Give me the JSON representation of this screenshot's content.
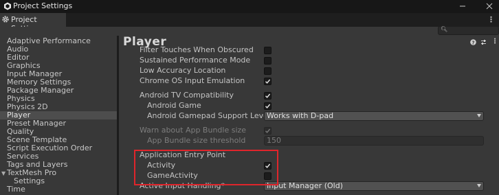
{
  "window": {
    "title": "Project Settings",
    "tab_label": "Project Settings"
  },
  "sidebar": {
    "items": [
      {
        "label": "Adaptive Performance"
      },
      {
        "label": "Audio"
      },
      {
        "label": "Editor"
      },
      {
        "label": "Graphics"
      },
      {
        "label": "Input Manager"
      },
      {
        "label": "Memory Settings"
      },
      {
        "label": "Package Manager"
      },
      {
        "label": "Physics"
      },
      {
        "label": "Physics 2D"
      },
      {
        "label": "Player",
        "selected": true
      },
      {
        "label": "Preset Manager"
      },
      {
        "label": "Quality"
      },
      {
        "label": "Scene Template"
      },
      {
        "label": "Script Execution Order"
      },
      {
        "label": "Services"
      },
      {
        "label": "Tags and Layers"
      },
      {
        "label": "TextMesh Pro",
        "foldout": "expanded"
      },
      {
        "label": "Settings",
        "indent": 1
      },
      {
        "label": "Time"
      }
    ]
  },
  "main": {
    "title": "Player",
    "rows": [
      {
        "label": "Filter Touches When Obscured",
        "checked": false
      },
      {
        "label": "Sustained Performance Mode",
        "checked": false
      },
      {
        "label": "Low Accuracy Location",
        "checked": false
      },
      {
        "label": "Chrome OS Input Emulation",
        "checked": true
      },
      {
        "label": "Android TV Compatibility",
        "checked": true
      },
      {
        "label": "Android Game",
        "checked": true
      },
      {
        "label": "Android Gamepad Support Level",
        "value": "Works with D-pad"
      },
      {
        "label": "Warn about App Bundle size",
        "checked": true,
        "disabled": true
      },
      {
        "label": "App Bundle size threshold",
        "value": "150",
        "disabled": true
      },
      {
        "label": "Application Entry Point"
      },
      {
        "label": "Activity",
        "checked": true
      },
      {
        "label": "GameActivity",
        "checked": false
      },
      {
        "label": "Active Input Handling*",
        "value": "Input Manager (Old)"
      }
    ]
  },
  "colors": {
    "highlight_box": "#e0252b",
    "selected_item_bg": "#4d4d4d",
    "panel_bg": "#383838"
  }
}
